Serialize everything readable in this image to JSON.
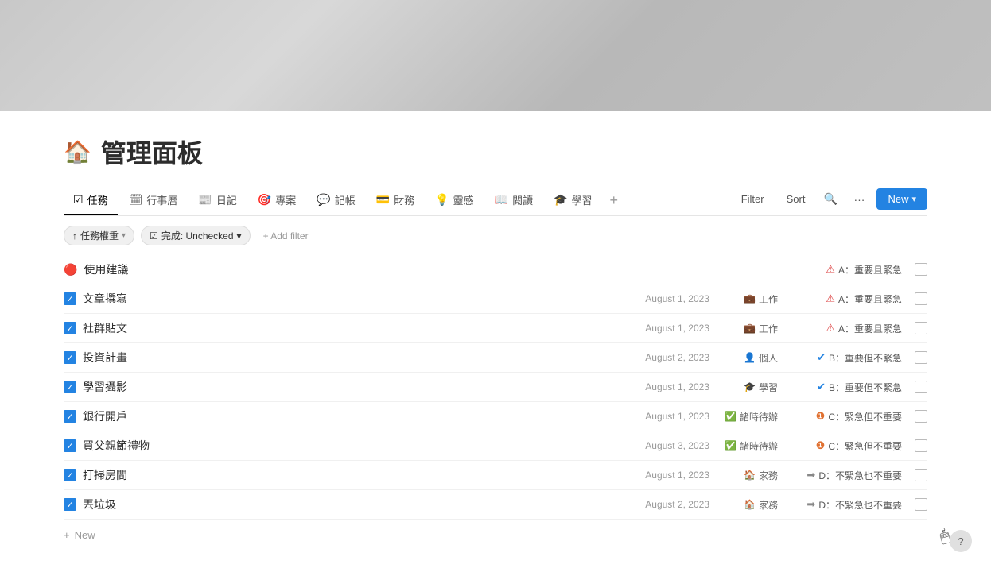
{
  "header": {
    "banner_alt": "decorative banner"
  },
  "page": {
    "icon": "🏠",
    "title": "管理面板"
  },
  "tabs": [
    {
      "id": "tasks",
      "icon": "☑",
      "label": "任務",
      "active": true
    },
    {
      "id": "calendar",
      "icon": "🗓",
      "label": "行事曆",
      "active": false
    },
    {
      "id": "diary",
      "icon": "📰",
      "label": "日記",
      "active": false
    },
    {
      "id": "project",
      "icon": "🎯",
      "label": "專案",
      "active": false
    },
    {
      "id": "ledger",
      "icon": "💬",
      "label": "記帳",
      "active": false
    },
    {
      "id": "finance",
      "icon": "💳",
      "label": "財務",
      "active": false
    },
    {
      "id": "ideas",
      "icon": "💡",
      "label": "靈感",
      "active": false
    },
    {
      "id": "reading",
      "icon": "📖",
      "label": "閱讀",
      "active": false
    },
    {
      "id": "learning",
      "icon": "🎓",
      "label": "學習",
      "active": false
    }
  ],
  "toolbar": {
    "filter_label": "Filter",
    "sort_label": "Sort",
    "more_label": "···",
    "new_label": "New"
  },
  "filters": [
    {
      "id": "priority",
      "icon": "↑",
      "label": "任務權重",
      "has_arrow": true
    },
    {
      "id": "done",
      "icon": "☑",
      "label": "完成: Unchecked",
      "has_arrow": true
    }
  ],
  "add_filter_label": "+ Add filter",
  "tasks": [
    {
      "id": 1,
      "checked": false,
      "status_icon": "🔴",
      "name": "使用建議",
      "date": "",
      "category_icon": "",
      "category": "",
      "priority_icon": "⚠️",
      "priority": "A：重要且緊急",
      "priority_color": "#e03030"
    },
    {
      "id": 2,
      "checked": true,
      "status_icon": "☑",
      "name": "文章撰寫",
      "date": "August 1, 2023",
      "category_icon": "💼",
      "category": "工作",
      "priority_icon": "⚠️",
      "priority": "A：重要且緊急",
      "priority_color": "#e03030"
    },
    {
      "id": 3,
      "checked": true,
      "status_icon": "☑",
      "name": "社群貼文",
      "date": "August 1, 2023",
      "category_icon": "💼",
      "category": "工作",
      "priority_icon": "⚠️",
      "priority": "A：重要且緊急",
      "priority_color": "#e03030"
    },
    {
      "id": 4,
      "checked": true,
      "status_icon": "☑",
      "name": "投資計畫",
      "date": "August 2, 2023",
      "category_icon": "👤",
      "category": "個人",
      "priority_icon": "🔵",
      "priority": "B：重要但不緊急",
      "priority_color": "#2383e2"
    },
    {
      "id": 5,
      "checked": true,
      "status_icon": "☑",
      "name": "學習攝影",
      "date": "August 1, 2023",
      "category_icon": "🎓",
      "category": "學習",
      "priority_icon": "🔵",
      "priority": "B：重要但不緊急",
      "priority_color": "#2383e2"
    },
    {
      "id": 6,
      "checked": true,
      "status_icon": "☑",
      "name": "銀行開戶",
      "date": "August 1, 2023",
      "category_icon": "✅",
      "category": "諸時待辦",
      "priority_icon": "🟠",
      "priority": "C：緊急但不重要",
      "priority_color": "#e07030"
    },
    {
      "id": 7,
      "checked": true,
      "status_icon": "☑",
      "name": "買父親節禮物",
      "date": "August 3, 2023",
      "category_icon": "✅",
      "category": "諸時待辦",
      "priority_icon": "🟠",
      "priority": "C：緊急但不重要",
      "priority_color": "#e07030"
    },
    {
      "id": 8,
      "checked": true,
      "status_icon": "☑",
      "name": "打掃房間",
      "date": "August 1, 2023",
      "category_icon": "🏠",
      "category": "家務",
      "priority_icon": "⭕",
      "priority": "D：不緊急也不重要",
      "priority_color": "#888"
    },
    {
      "id": 9,
      "checked": true,
      "status_icon": "☑",
      "name": "丟垃圾",
      "date": "August 2, 2023",
      "category_icon": "🏠",
      "category": "家務",
      "priority_icon": "⭕",
      "priority": "D：不緊急也不重要",
      "priority_color": "#888"
    }
  ],
  "new_task_label": "New",
  "help_label": "?"
}
